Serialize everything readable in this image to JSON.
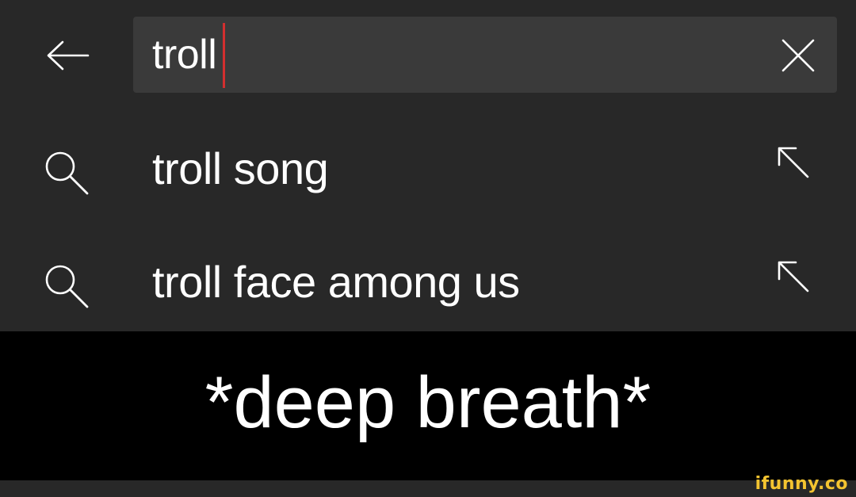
{
  "search": {
    "query": "troll",
    "back_icon": "arrow-left-icon",
    "clear_icon": "close-icon"
  },
  "suggestions": [
    {
      "label": "troll song",
      "icon": "search-icon",
      "action_icon": "arrow-up-left-icon"
    },
    {
      "label": "troll face among us",
      "icon": "search-icon",
      "action_icon": "arrow-up-left-icon"
    }
  ],
  "caption": {
    "text": "*deep breath*"
  },
  "watermark": {
    "text": "ifunny.co"
  },
  "colors": {
    "panel_bg": "#282828",
    "search_box_bg": "#3a3a3a",
    "caret": "#d32f2f",
    "text": "#ffffff",
    "icon": "#ffffff",
    "caption_bg": "#000000",
    "watermark": "#f4c430"
  }
}
